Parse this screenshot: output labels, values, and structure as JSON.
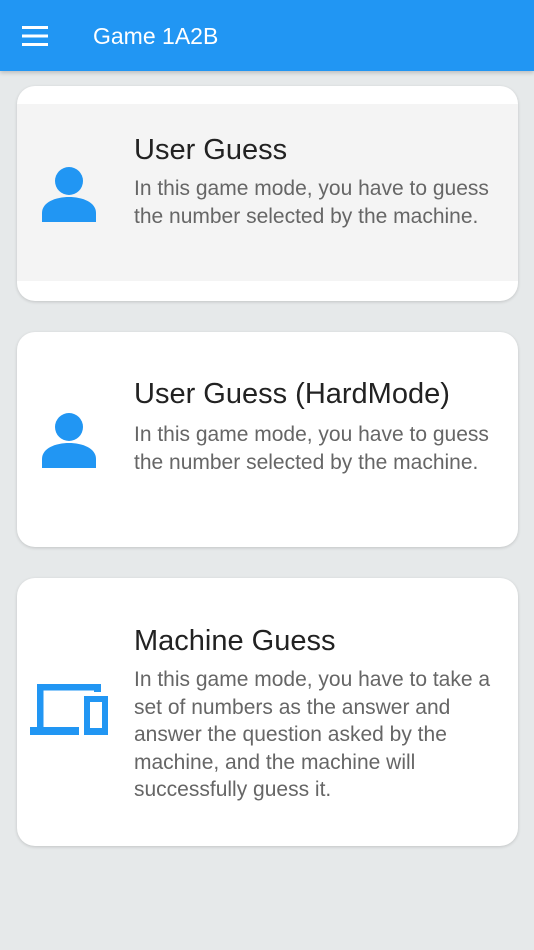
{
  "appbar": {
    "title": "Game 1A2B",
    "menu_icon": "hamburger-menu-icon",
    "color": "#2196f3"
  },
  "modes": [
    {
      "title": "User Guess",
      "description": "In this game mode, you have to guess the number selected by the machine.",
      "icon": "person-icon"
    },
    {
      "title": "User Guess (HardMode)",
      "description": "In this game mode, you have to guess the number selected by the machine.",
      "icon": "person-icon"
    },
    {
      "title": "Machine Guess",
      "description": "In this game mode, you have to take a set of numbers as the answer and answer the question asked by the machine, and the machine will successfully guess it.",
      "icon": "devices-icon"
    }
  ],
  "colors": {
    "accent": "#2196f3",
    "background": "#e6e9ea",
    "card": "#ffffff",
    "title_text": "#222222",
    "description_text": "#666666"
  }
}
